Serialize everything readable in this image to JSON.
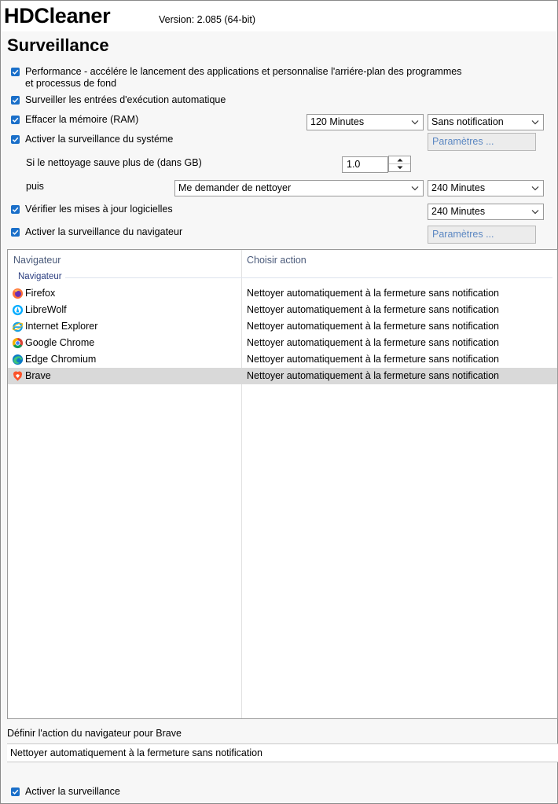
{
  "app": {
    "name": "HDCleaner",
    "version": "Version: 2.085 (64-bit)"
  },
  "page": {
    "title": "Surveillance"
  },
  "options": {
    "performance": {
      "label_line1": "Performance - accélére le lancement des applications et personnalise l'arriére-plan des programmes",
      "label_line2": "et processus de fond",
      "checked": true
    },
    "autorun": {
      "label": "Surveiller les entrées d'exécution automatique",
      "checked": true
    },
    "ram": {
      "label": "Effacer la mémoire (RAM)",
      "checked": true,
      "interval": "120 Minutes",
      "notification": "Sans notification"
    },
    "system": {
      "label": "Activer la surveillance du systéme",
      "checked": true,
      "settings_button": "Paramètres ..."
    },
    "cleanup_threshold": {
      "label": "Si le nettoyage sauve plus de (dans GB)",
      "value": "1.0"
    },
    "then": {
      "label": "puis",
      "action": "Me demander de nettoyer",
      "interval": "240 Minutes"
    },
    "updates": {
      "label": "Vérifier les mises à jour logicielles",
      "checked": true,
      "interval": "240 Minutes"
    },
    "browser": {
      "label": "Activer la surveillance du navigateur",
      "checked": true,
      "settings_button": "Paramètres ..."
    }
  },
  "browser_list": {
    "columns": [
      "Navigateur",
      "Choisir action"
    ],
    "group": "Navigateur",
    "rows": [
      {
        "name": "Firefox",
        "icon": "firefox-icon",
        "action": "Nettoyer automatiquement à la fermeture sans notification"
      },
      {
        "name": "LibreWolf",
        "icon": "librewolf-icon",
        "action": "Nettoyer automatiquement à la fermeture sans notification"
      },
      {
        "name": "Internet Explorer",
        "icon": "internet-explorer-icon",
        "action": "Nettoyer automatiquement à la fermeture sans notification"
      },
      {
        "name": "Google Chrome",
        "icon": "chrome-icon",
        "action": "Nettoyer automatiquement à la fermeture sans notification"
      },
      {
        "name": "Edge Chromium",
        "icon": "edge-icon",
        "action": "Nettoyer automatiquement à la fermeture sans notification"
      },
      {
        "name": "Brave",
        "icon": "brave-icon",
        "action": "Nettoyer automatiquement à la fermeture sans notification",
        "selected": true
      }
    ]
  },
  "define_action": {
    "label": "Définir l'action du navigateur pour Brave",
    "value": "Nettoyer automatiquement à la fermeture sans notification"
  },
  "enable_monitoring": {
    "label": "Activer la surveillance",
    "checked": true
  },
  "colors": {
    "checkbox": "#1a6fc9",
    "selected_row": "#d9d9d9",
    "link_disabled": "#5b87c2"
  }
}
